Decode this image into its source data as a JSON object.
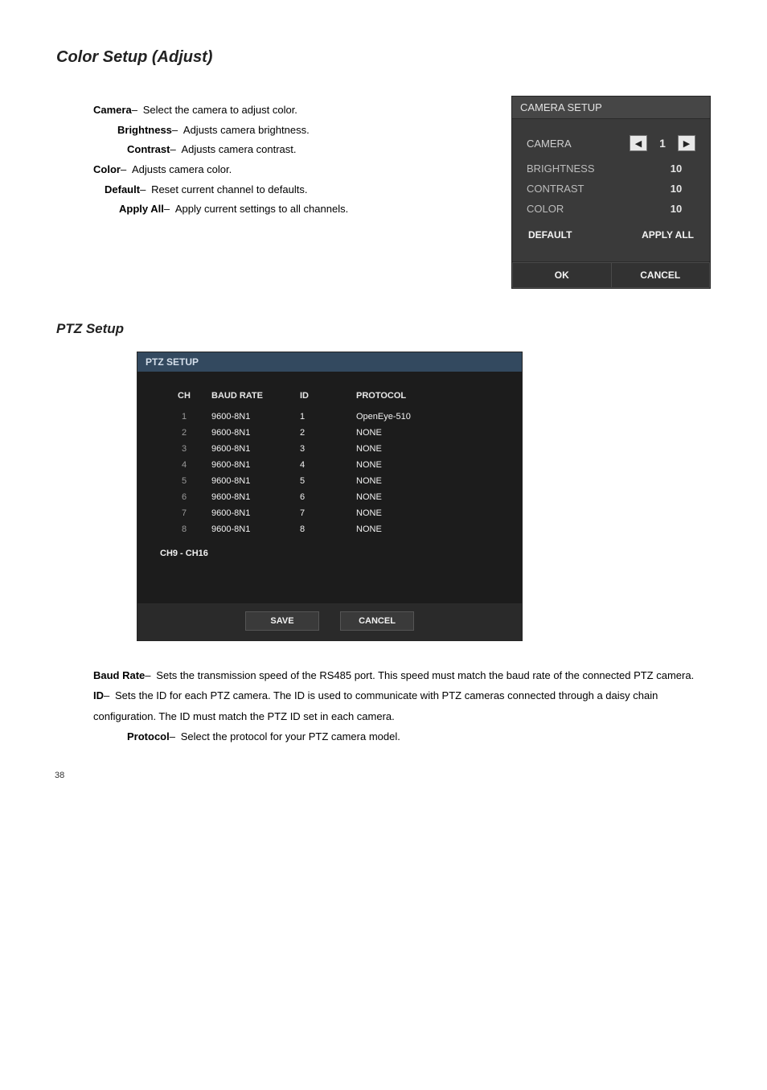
{
  "page_number": "38",
  "section_title": "Color Setup (Adjust)",
  "color_bullets": {
    "camera": {
      "label": "Camera",
      "desc": "Select the camera to adjust color. "
    },
    "brightness": {
      "label": "Brightness",
      "desc": "Adjusts camera brightness."
    },
    "contrast": {
      "label": "Contrast",
      "desc": "Adjusts camera contrast."
    },
    "color": {
      "label": "Color",
      "desc": "Adjusts camera color."
    },
    "default": {
      "label": "Default",
      "desc": "Reset current channel to defaults."
    },
    "apply_all": {
      "label": "Apply All",
      "desc": "Apply current settings to all channels."
    }
  },
  "camera_panel": {
    "title": "CAMERA SETUP",
    "camera_label": "CAMERA",
    "camera_value": "1",
    "rows": [
      {
        "label": "BRIGHTNESS",
        "value": "10"
      },
      {
        "label": "CONTRAST",
        "value": "10"
      },
      {
        "label": "COLOR",
        "value": "10"
      }
    ],
    "default_btn": "DEFAULT",
    "applyall_btn": "APPLY ALL",
    "ok_btn": "OK",
    "cancel_btn": "CANCEL"
  },
  "ptz_section_title": "PTZ Setup",
  "ptz_panel": {
    "title": "PTZ SETUP",
    "headers": {
      "ch": "CH",
      "baud": "BAUD RATE",
      "id": "ID",
      "protocol": "PROTOCOL"
    },
    "rows": [
      {
        "ch": "1",
        "baud": "9600-8N1",
        "id": "1",
        "protocol": "OpenEye-510"
      },
      {
        "ch": "2",
        "baud": "9600-8N1",
        "id": "2",
        "protocol": "NONE"
      },
      {
        "ch": "3",
        "baud": "9600-8N1",
        "id": "3",
        "protocol": "NONE"
      },
      {
        "ch": "4",
        "baud": "9600-8N1",
        "id": "4",
        "protocol": "NONE"
      },
      {
        "ch": "5",
        "baud": "9600-8N1",
        "id": "5",
        "protocol": "NONE"
      },
      {
        "ch": "6",
        "baud": "9600-8N1",
        "id": "6",
        "protocol": "NONE"
      },
      {
        "ch": "7",
        "baud": "9600-8N1",
        "id": "7",
        "protocol": "NONE"
      },
      {
        "ch": "8",
        "baud": "9600-8N1",
        "id": "8",
        "protocol": "NONE"
      }
    ],
    "more_link": "CH9 - CH16",
    "save_btn": "SAVE",
    "cancel_btn": "CANCEL"
  },
  "ptz_defs": {
    "baud": {
      "label": "Baud Rate",
      "desc": "Sets the transmission speed of the RS485 port. This speed must match the baud rate of the connected PTZ camera."
    },
    "id": {
      "label": "ID",
      "desc": "Sets the ID for each PTZ camera. The ID is used to communicate with PTZ cameras connected through a daisy chain configuration. The ID must match the PTZ ID set in each camera."
    },
    "protocol": {
      "label": "Protocol",
      "desc": "Select the protocol for your PTZ camera model."
    }
  },
  "chart_data": {
    "type": "table",
    "title": "PTZ SETUP",
    "columns": [
      "CH",
      "BAUD RATE",
      "ID",
      "PROTOCOL"
    ],
    "rows": [
      [
        "1",
        "9600-8N1",
        "1",
        "OpenEye-510"
      ],
      [
        "2",
        "9600-8N1",
        "2",
        "NONE"
      ],
      [
        "3",
        "9600-8N1",
        "3",
        "NONE"
      ],
      [
        "4",
        "9600-8N1",
        "4",
        "NONE"
      ],
      [
        "5",
        "9600-8N1",
        "5",
        "NONE"
      ],
      [
        "6",
        "9600-8N1",
        "6",
        "NONE"
      ],
      [
        "7",
        "9600-8N1",
        "7",
        "NONE"
      ],
      [
        "8",
        "9600-8N1",
        "8",
        "NONE"
      ]
    ]
  }
}
